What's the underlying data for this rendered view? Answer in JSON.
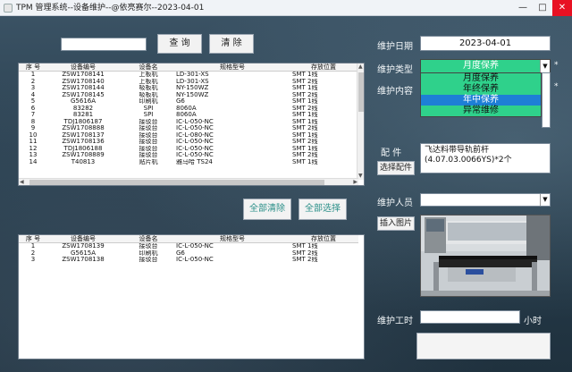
{
  "window": {
    "title": "TPM 管理系统--设备维护--@依亮赛尔--2023-04-01",
    "min": "—",
    "max": "□",
    "close": "✕"
  },
  "search": {
    "value": "",
    "query_label": "查 询",
    "clear_label": "清 除"
  },
  "table1": {
    "columns": [
      "序 号",
      "设备编号",
      "设备名",
      "规格型号",
      "存放位置"
    ],
    "rows": [
      [
        "1",
        "ZSW1708141",
        "上板机",
        "LD-301-XS",
        "SMT 1线"
      ],
      [
        "2",
        "ZSW1708140",
        "上板机",
        "LD-301-XS",
        "SMT 2线"
      ],
      [
        "3",
        "ZSW1708144",
        "吸板机",
        "NY-150WZ",
        "SMT 1线"
      ],
      [
        "4",
        "ZSW1708145",
        "吸板机",
        "NY-150WZ",
        "SMT 2线"
      ],
      [
        "5",
        "G5616A",
        "印刷机",
        "G6",
        "SMT 1线"
      ],
      [
        "6",
        "83282",
        "SPI",
        "8060A",
        "SMT 2线"
      ],
      [
        "7",
        "83281",
        "SPI",
        "8060A",
        "SMT 1线"
      ],
      [
        "8",
        "TDJ1806187",
        "接驳台",
        "IC-L-050-NC",
        "SMT 1线"
      ],
      [
        "9",
        "ZSW1708888",
        "接驳台",
        "IC-L-050-NC",
        "SMT 2线"
      ],
      [
        "10",
        "ZSW1708137",
        "接驳台",
        "IC-L-080-NC",
        "SMT 1线"
      ],
      [
        "11",
        "ZSW1708136",
        "接驳台",
        "IC-L-050-NC",
        "SMT 2线"
      ],
      [
        "12",
        "TDJ1806188",
        "接驳台",
        "IC-L-050-NC",
        "SMT 1线"
      ],
      [
        "13",
        "ZSW1708889",
        "接驳台",
        "IC-L-050-NC",
        "SMT 2线"
      ],
      [
        "14",
        "T40813",
        "贴片机",
        "雅马哈 TS24",
        "SMT 1线"
      ]
    ]
  },
  "mid_buttons": {
    "clear_all": "全部清除",
    "select_all": "全部选择"
  },
  "table2": {
    "columns": [
      "序 号",
      "设备编号",
      "设备名",
      "规格型号",
      "存放位置"
    ],
    "rows": [
      [
        "1",
        "ZSW1708139",
        "接驳台",
        "IC-L-050-NC",
        "SMT 1线"
      ],
      [
        "2",
        "G5615A",
        "印刷机",
        "G6",
        "SMT 2线"
      ],
      [
        "3",
        "ZSW1708138",
        "接驳台",
        "IC-L-050-NC",
        "SMT 2线"
      ]
    ]
  },
  "form": {
    "date_label": "维护日期",
    "date_value": "2023-04-01",
    "type_label": "维护类型",
    "type_value": "月度保养",
    "type_options": [
      "月度保养",
      "年终保养",
      "年中保养",
      "异常维修"
    ],
    "type_selected_index": 2,
    "content_label": "维护内容",
    "required_mark": "*",
    "parts_label": "配  件",
    "parts_button": "选择配件",
    "parts_text": "飞达料带导轨前杆\n(4.07.03.0066YS)*2个",
    "person_label": "维护人员",
    "person_value": "",
    "insert_image_button": "插入图片",
    "hours_label": "维护工时",
    "hours_value": "",
    "hours_unit": "小时"
  },
  "colors": {
    "option_bg": "#2fd18b",
    "option_selected": "#1e7fd6",
    "accent_teal": "#2a8f88"
  }
}
